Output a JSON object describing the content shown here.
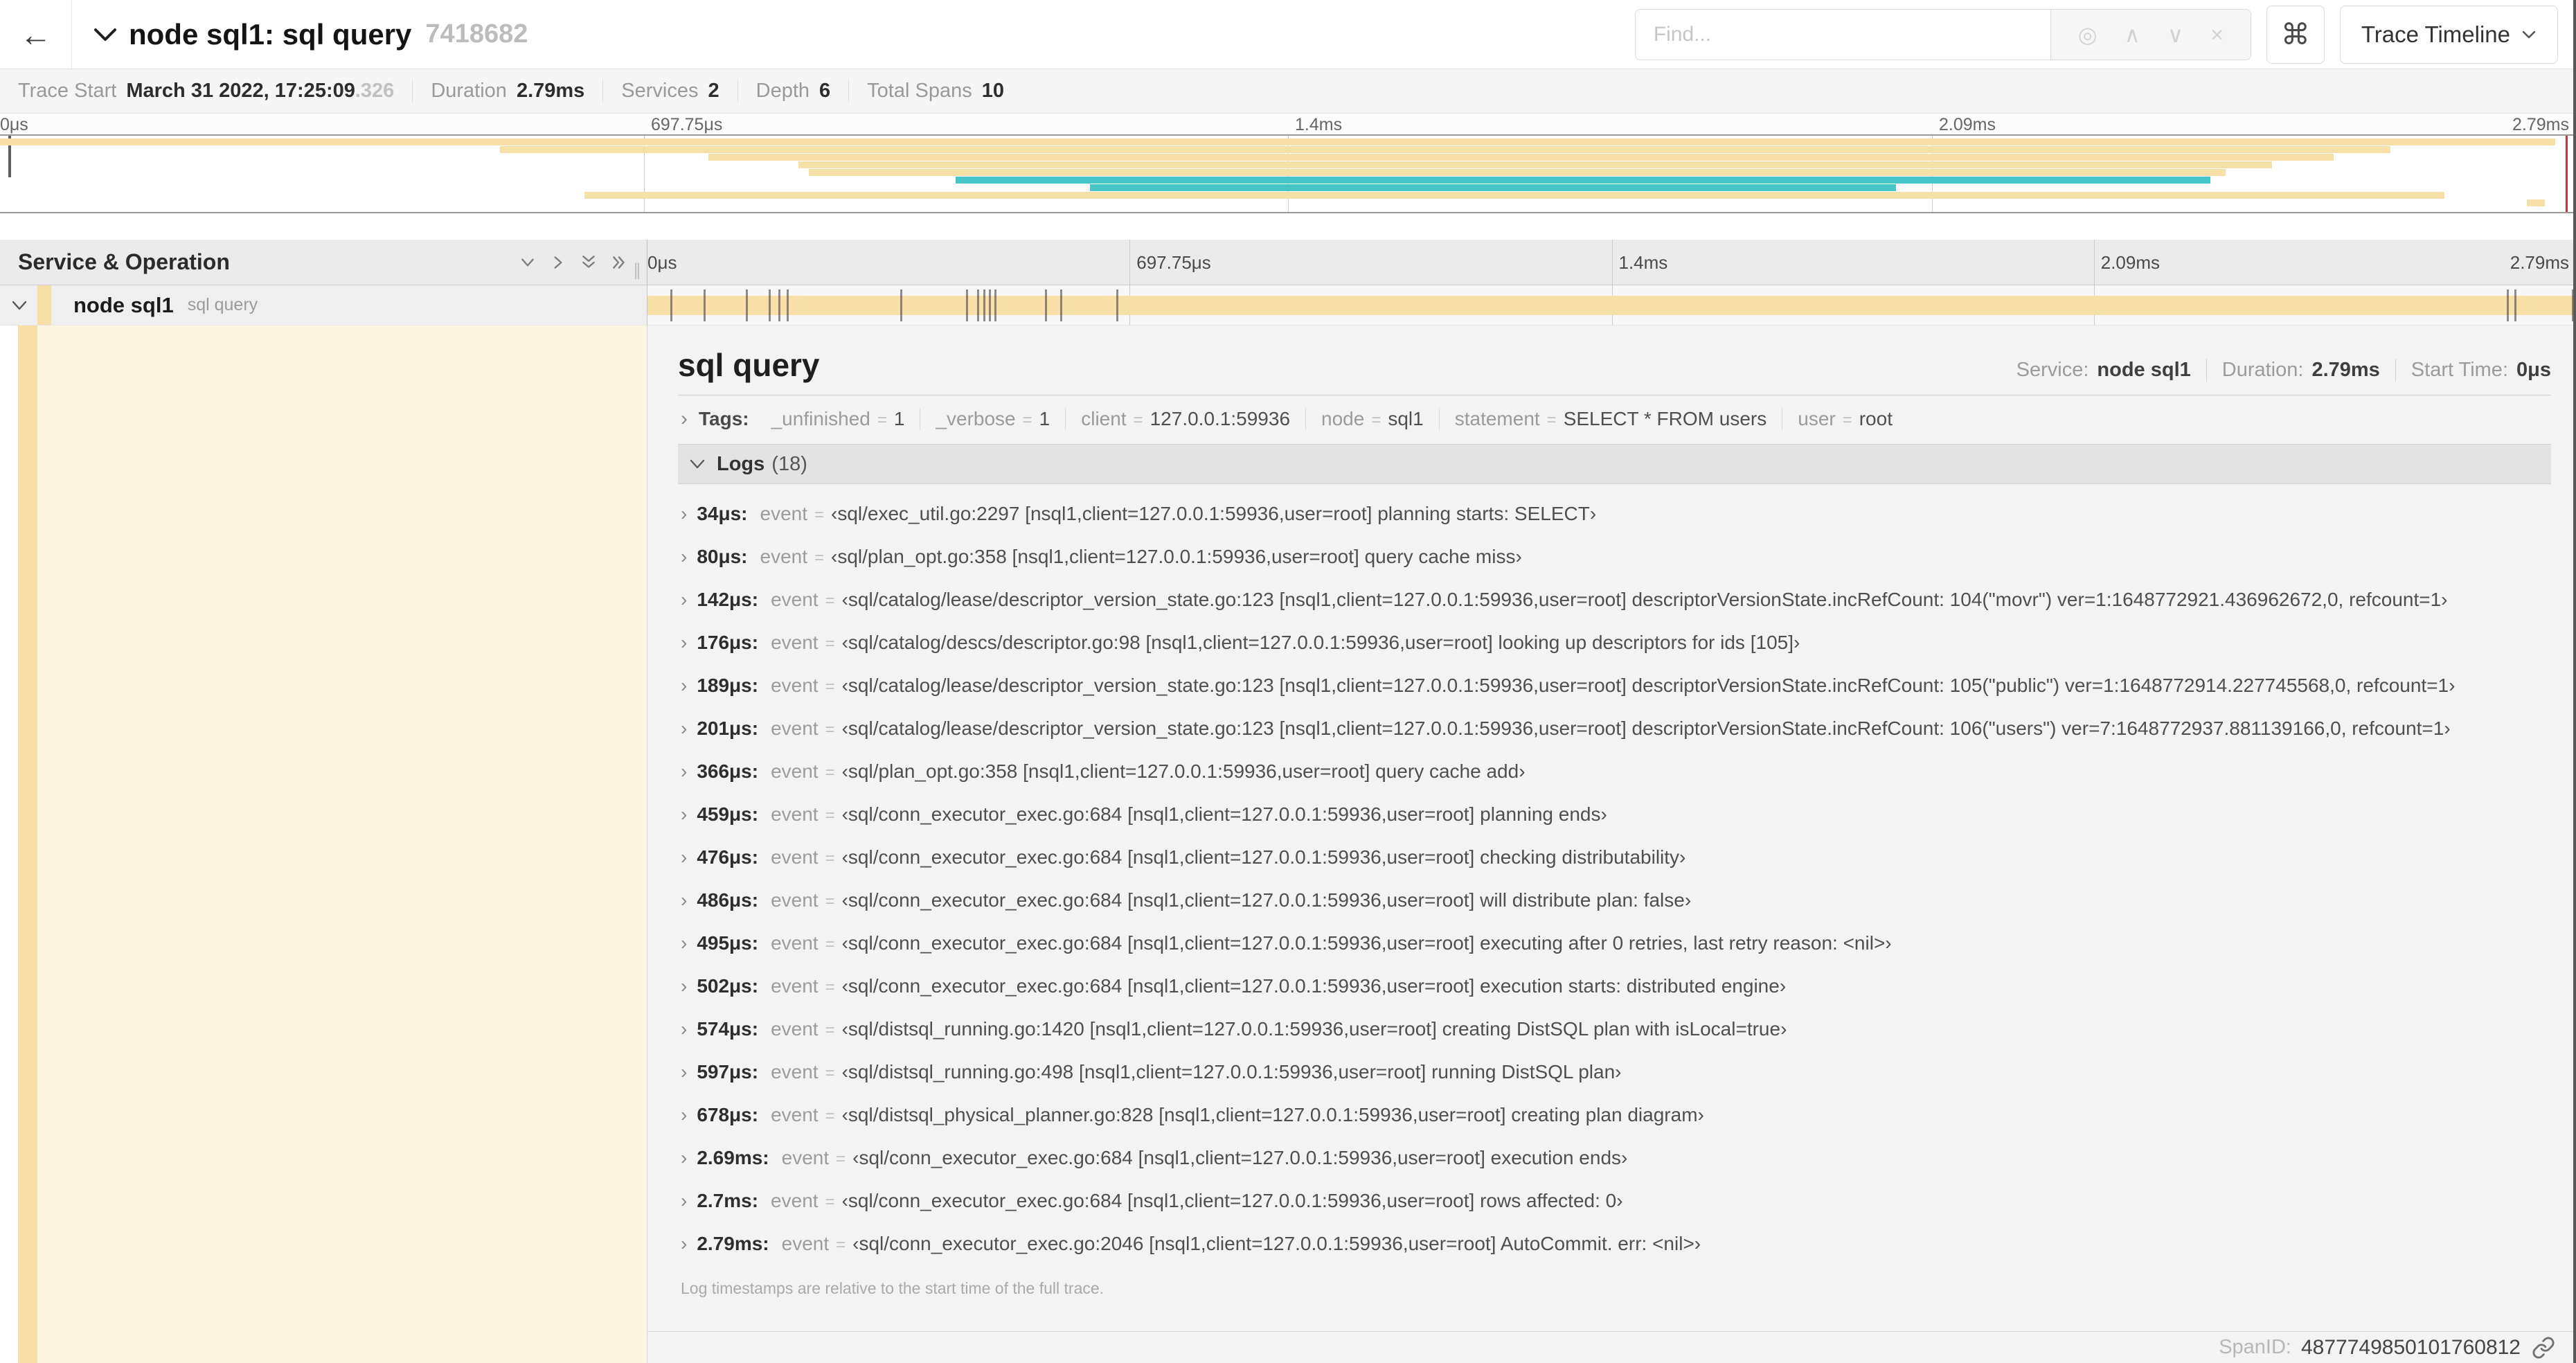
{
  "colors": {
    "span_orange": "#f7dfa8",
    "span_teal": "#45c5c5",
    "cursor_red": "#c8363c",
    "cream": "#fcf5e1"
  },
  "icons": {
    "back": "←",
    "cmd": "⌘",
    "find_target": "◎",
    "find_up": "∧",
    "find_down": "∨",
    "find_close": "×",
    "expand_right": "›",
    "drag_handle": "∥"
  },
  "header": {
    "title": "node sql1: sql query",
    "trace_id_short": "7418682",
    "find_placeholder": "Find...",
    "view_select_label": "Trace Timeline"
  },
  "summary": {
    "items": [
      {
        "label": "Trace Start",
        "value": "March 31 2022, 17:25:09",
        "extra": ".326"
      },
      {
        "label": "Duration",
        "value": "2.79ms",
        "extra": ""
      },
      {
        "label": "Services",
        "value": "2",
        "extra": ""
      },
      {
        "label": "Depth",
        "value": "6",
        "extra": ""
      },
      {
        "label": "Total Spans",
        "value": "10",
        "extra": ""
      }
    ]
  },
  "minimap": {
    "ticks": [
      "0μs",
      "697.75μs",
      "1.4ms",
      "2.09ms",
      "2.79ms"
    ],
    "bars": [
      {
        "row": 0,
        "start": 0,
        "end": 99.2,
        "color": "span_orange"
      },
      {
        "row": 1,
        "start": 19.4,
        "end": 92.8,
        "color": "span_orange"
      },
      {
        "row": 2,
        "start": 27.5,
        "end": 90.6,
        "color": "span_orange"
      },
      {
        "row": 3,
        "start": 31.0,
        "end": 88.2,
        "color": "span_orange"
      },
      {
        "row": 4,
        "start": 31.4,
        "end": 86.4,
        "color": "span_orange"
      },
      {
        "row": 5,
        "start": 37.1,
        "end": 85.8,
        "color": "span_teal"
      },
      {
        "row": 6,
        "start": 42.3,
        "end": 73.6,
        "color": "span_teal"
      },
      {
        "row": 7,
        "start": 22.7,
        "end": 94.9,
        "color": "span_orange"
      },
      {
        "row": 8,
        "start": 98.1,
        "end": 98.8,
        "color": "span_orange"
      }
    ]
  },
  "timeline": {
    "left_header": "Service & Operation",
    "ticks": [
      "0μs",
      "697.75μs",
      "1.4ms",
      "2.09ms",
      "2.79ms"
    ]
  },
  "span_row": {
    "service": "node sql1",
    "operation": "sql query",
    "log_marker_percents": [
      1.2,
      2.9,
      5.1,
      6.3,
      6.8,
      7.2,
      13.1,
      16.5,
      17.1,
      17.4,
      17.7,
      18.0,
      20.6,
      21.4,
      24.3,
      96.4,
      96.8,
      99.8
    ]
  },
  "detail": {
    "title": "sql query",
    "meta": [
      {
        "label": "Service:",
        "value": "node sql1"
      },
      {
        "label": "Duration:",
        "value": "2.79ms"
      },
      {
        "label": "Start Time:",
        "value": "0μs"
      }
    ],
    "tags_label": "Tags:",
    "tags": [
      {
        "key": "_unfinished",
        "value": "1"
      },
      {
        "key": "_verbose",
        "value": "1"
      },
      {
        "key": "client",
        "value": "127.0.0.1:59936"
      },
      {
        "key": "node",
        "value": "sql1"
      },
      {
        "key": "statement",
        "value": "SELECT * FROM users"
      },
      {
        "key": "user",
        "value": "root"
      }
    ],
    "logs_label": "Logs",
    "logs_count": "(18)",
    "logs": [
      {
        "time": "34μs:",
        "field": "event",
        "value": "‹sql/exec_util.go:2297 [nsql1,client=127.0.0.1:59936,user=root] planning starts: SELECT›"
      },
      {
        "time": "80μs:",
        "field": "event",
        "value": "‹sql/plan_opt.go:358 [nsql1,client=127.0.0.1:59936,user=root] query cache miss›"
      },
      {
        "time": "142μs:",
        "field": "event",
        "value": "‹sql/catalog/lease/descriptor_version_state.go:123 [nsql1,client=127.0.0.1:59936,user=root] descriptorVersionState.incRefCount: 104(\"movr\") ver=1:1648772921.436962672,0, refcount=1›"
      },
      {
        "time": "176μs:",
        "field": "event",
        "value": "‹sql/catalog/descs/descriptor.go:98 [nsql1,client=127.0.0.1:59936,user=root] looking up descriptors for ids [105]›"
      },
      {
        "time": "189μs:",
        "field": "event",
        "value": "‹sql/catalog/lease/descriptor_version_state.go:123 [nsql1,client=127.0.0.1:59936,user=root] descriptorVersionState.incRefCount: 105(\"public\") ver=1:1648772914.227745568,0, refcount=1›"
      },
      {
        "time": "201μs:",
        "field": "event",
        "value": "‹sql/catalog/lease/descriptor_version_state.go:123 [nsql1,client=127.0.0.1:59936,user=root] descriptorVersionState.incRefCount: 106(\"users\") ver=7:1648772937.881139166,0, refcount=1›"
      },
      {
        "time": "366μs:",
        "field": "event",
        "value": "‹sql/plan_opt.go:358 [nsql1,client=127.0.0.1:59936,user=root] query cache add›"
      },
      {
        "time": "459μs:",
        "field": "event",
        "value": "‹sql/conn_executor_exec.go:684 [nsql1,client=127.0.0.1:59936,user=root] planning ends›"
      },
      {
        "time": "476μs:",
        "field": "event",
        "value": "‹sql/conn_executor_exec.go:684 [nsql1,client=127.0.0.1:59936,user=root] checking distributability›"
      },
      {
        "time": "486μs:",
        "field": "event",
        "value": "‹sql/conn_executor_exec.go:684 [nsql1,client=127.0.0.1:59936,user=root] will distribute plan: false›"
      },
      {
        "time": "495μs:",
        "field": "event",
        "value": "‹sql/conn_executor_exec.go:684 [nsql1,client=127.0.0.1:59936,user=root] executing after 0 retries, last retry reason: <nil>›"
      },
      {
        "time": "502μs:",
        "field": "event",
        "value": "‹sql/conn_executor_exec.go:684 [nsql1,client=127.0.0.1:59936,user=root] execution starts: distributed engine›"
      },
      {
        "time": "574μs:",
        "field": "event",
        "value": "‹sql/distsql_running.go:1420 [nsql1,client=127.0.0.1:59936,user=root] creating DistSQL plan with isLocal=true›"
      },
      {
        "time": "597μs:",
        "field": "event",
        "value": "‹sql/distsql_running.go:498 [nsql1,client=127.0.0.1:59936,user=root] running DistSQL plan›"
      },
      {
        "time": "678μs:",
        "field": "event",
        "value": "‹sql/distsql_physical_planner.go:828 [nsql1,client=127.0.0.1:59936,user=root] creating plan diagram›"
      },
      {
        "time": "2.69ms:",
        "field": "event",
        "value": "‹sql/conn_executor_exec.go:684 [nsql1,client=127.0.0.1:59936,user=root] execution ends›"
      },
      {
        "time": "2.7ms:",
        "field": "event",
        "value": "‹sql/conn_executor_exec.go:684 [nsql1,client=127.0.0.1:59936,user=root] rows affected: 0›"
      },
      {
        "time": "2.79ms:",
        "field": "event",
        "value": "‹sql/conn_executor_exec.go:2046 [nsql1,client=127.0.0.1:59936,user=root] AutoCommit. err: <nil>›"
      }
    ],
    "logs_note": "Log timestamps are relative to the start time of the full trace.",
    "spanid_label": "SpanID:",
    "spanid": "4877749850101760812"
  }
}
